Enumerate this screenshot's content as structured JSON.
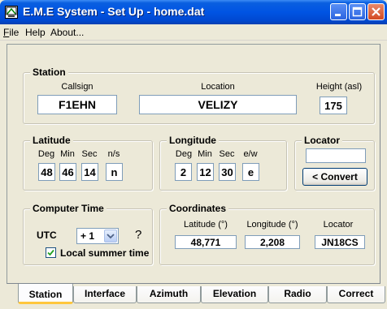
{
  "window": {
    "title": "E.M.E System - Set Up - home.dat"
  },
  "menu": {
    "file": {
      "first": "F",
      "rest": "ile"
    },
    "help": "Help",
    "about": "About..."
  },
  "station": {
    "legend": "Station",
    "callsign_label": "Callsign",
    "callsign": "F1EHN",
    "location_label": "Location",
    "location": "VELIZY",
    "height_label": "Height (asl)",
    "height": "175"
  },
  "latitude": {
    "legend": "Latitude",
    "labels": [
      "Deg",
      "Min",
      "Sec",
      "n/s"
    ],
    "values": [
      "48",
      "46",
      "14",
      "n"
    ]
  },
  "longitude": {
    "legend": "Longitude",
    "labels": [
      "Deg",
      "Min",
      "Sec",
      "e/w"
    ],
    "values": [
      "2",
      "12",
      "30",
      "e"
    ]
  },
  "locator": {
    "legend": "Locator",
    "value": "",
    "convert_label": "< Convert"
  },
  "computer_time": {
    "legend": "Computer Time",
    "utc_label": "UTC",
    "utc_offset": "+ 1",
    "help": "?",
    "summer_label": "Local summer time",
    "summer_checked": true
  },
  "coordinates": {
    "legend": "Coordinates",
    "lat_label": "Latitude (°)",
    "lat": "48,771",
    "lon_label": "Longitude (°)",
    "lon": "2,208",
    "loc_label": "Locator",
    "loc": "JN18CS"
  },
  "tabs": [
    "Station",
    "Interface",
    "Azimuth",
    "Elevation",
    "Radio",
    "Correct"
  ],
  "active_tab": "Station"
}
